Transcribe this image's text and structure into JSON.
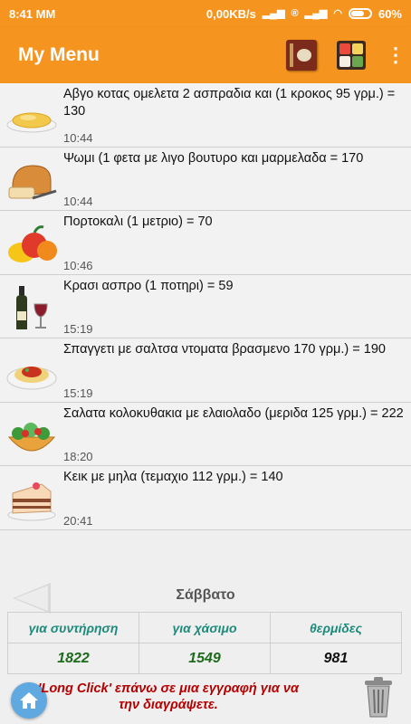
{
  "status_bar": {
    "time": "8:41 MM",
    "speed": "0,00KB/s",
    "battery": "60%"
  },
  "app_bar": {
    "title": "My Menu",
    "book_icon": "recipe-book-icon",
    "bento_icon": "bento-box-icon",
    "overflow_icon": "more-vert-icon"
  },
  "entries": [
    {
      "icon": "omelette-icon",
      "description": "Αβγο κοτας ομελετα 2 ασπραδια και (1 κροκος 95 γρμ.) =     130",
      "time": "10:44"
    },
    {
      "icon": "bread-icon",
      "description": "Ψωμι (1 φετα με λιγο βουτυρο και μαρμελαδα = 170",
      "time": "10:44"
    },
    {
      "icon": "fruit-icon",
      "description": "Πορτοκαλι (1 μετριο) =     70",
      "time": "10:46"
    },
    {
      "icon": "wine-icon",
      "description": "Κρασι ασπρο (1 ποτηρι) =     59",
      "time": "15:19"
    },
    {
      "icon": "spaghetti-icon",
      "description": "Σπαγγετι με σαλτσα ντοματα βρασμενο 170 γρμ.) = 190",
      "time": "15:19"
    },
    {
      "icon": "salad-icon",
      "description": "Σαλατα κολοκυθακια με ελαιολαδο (μεριδα 125 γρμ.) =    222",
      "time": "18:20"
    },
    {
      "icon": "cake-icon",
      "description": "Κεικ με μηλα (τεμαχιο 112 γρμ.) =     140",
      "time": "20:41"
    }
  ],
  "day": {
    "label": "Σάββατο",
    "prev_icon": "back-arrow-icon"
  },
  "totals": {
    "headers": [
      "για συντήρηση",
      "για χάσιμο",
      "θερμίδες"
    ],
    "values": [
      "1822",
      "1549",
      "981"
    ],
    "value_colors": [
      "#1e6b1e",
      "#1e6b1e",
      "#111111"
    ]
  },
  "footer": {
    "hint": "'Long Click' επάνω σε μια εγγραφή για να την διαγράψετε.",
    "home_icon": "home-icon",
    "trash_icon": "trash-icon"
  }
}
